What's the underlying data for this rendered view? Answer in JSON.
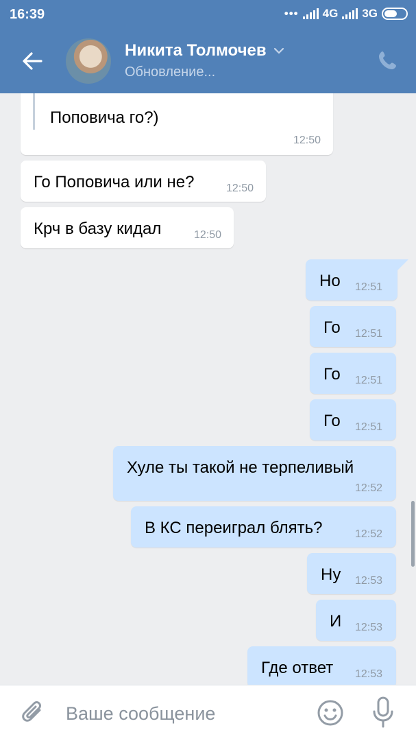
{
  "status_bar": {
    "time": "16:39",
    "network1": "4G",
    "network2": "3G"
  },
  "header": {
    "contact_name": "Никита Толмочев",
    "status": "Обновление..."
  },
  "messages": [
    {
      "dir": "in",
      "text": "Поповича го?)",
      "time": "12:50",
      "quoted": true
    },
    {
      "dir": "in",
      "text": "Го Поповича или не?",
      "time": "12:50"
    },
    {
      "dir": "in",
      "text": "Крч в базу кидал",
      "time": "12:50"
    },
    {
      "dir": "out",
      "text": "Но",
      "time": "12:51"
    },
    {
      "dir": "out",
      "text": "Го",
      "time": "12:51"
    },
    {
      "dir": "out",
      "text": "Го",
      "time": "12:51"
    },
    {
      "dir": "out",
      "text": "Го",
      "time": "12:51"
    },
    {
      "dir": "out",
      "text": "Хуле ты такой не терпеливый",
      "time": "12:52"
    },
    {
      "dir": "out",
      "text": "В КС переиграл блять?",
      "time": "12:52"
    },
    {
      "dir": "out",
      "text": "Ну",
      "time": "12:53"
    },
    {
      "dir": "out",
      "text": "И",
      "time": "12:53"
    },
    {
      "dir": "out",
      "text": "Где ответ",
      "time": "12:53"
    }
  ],
  "composer": {
    "placeholder": "Ваше сообщение"
  },
  "colors": {
    "header": "#5181b8",
    "chat_bg": "#edeef0",
    "incoming": "#ffffff",
    "outgoing": "#cce4ff"
  }
}
